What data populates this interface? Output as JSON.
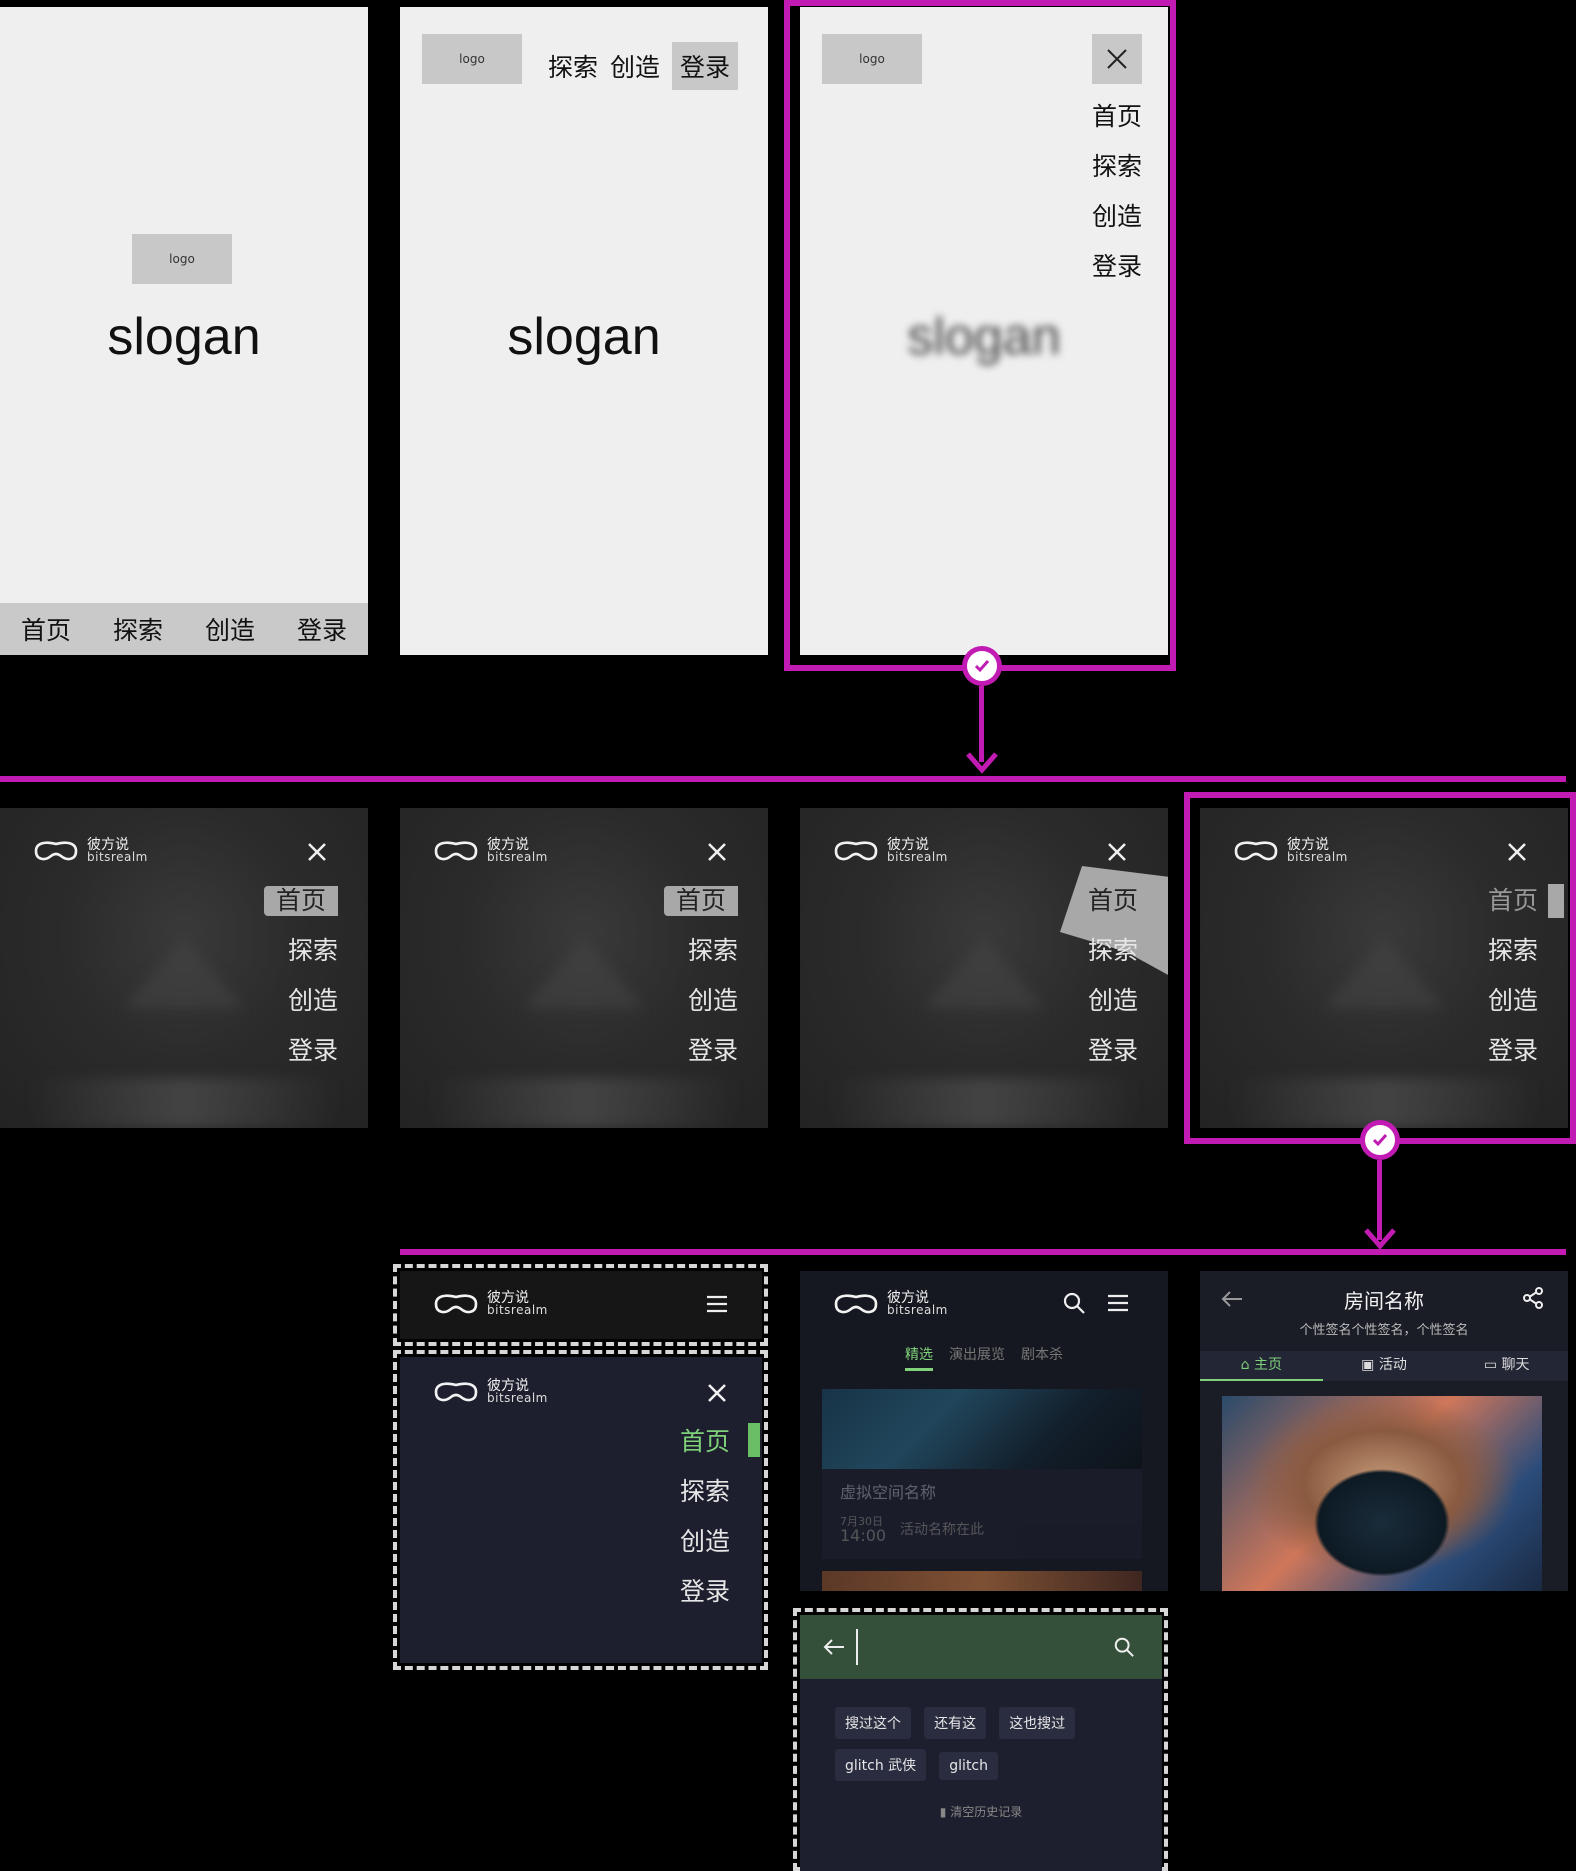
{
  "colors": {
    "accent_magenta": "#c21bb4",
    "accent_green": "#7fd27a",
    "dark_bg": "#2b2b2b",
    "navy_bg": "#1d1f2e",
    "search_header": "#34503a"
  },
  "wireframe": {
    "logo_label": "logo",
    "slogan": "slogan",
    "nav": [
      "首页",
      "探索",
      "创造",
      "登录"
    ],
    "top_nav": [
      "探索",
      "创造",
      "登录"
    ]
  },
  "brand": {
    "name_cn": "彼方说",
    "name_en": "bitsrealm"
  },
  "dark_menu": {
    "items": [
      "首页",
      "探索",
      "创造",
      "登录"
    ]
  },
  "feed": {
    "tabs": [
      "精选",
      "演出展览",
      "剧本杀"
    ],
    "card_title": "虚拟空间名称",
    "card_date": "7月30日",
    "card_time": "14:00",
    "card_activity": "活动名称在此"
  },
  "search": {
    "history": [
      "搜过这个",
      "还有这",
      "这也搜过",
      "glitch 武侠",
      "glitch"
    ],
    "clear_label": "清空历史记录"
  },
  "room": {
    "title": "房间名称",
    "signature": "个性签名个性签名，个性签名",
    "tabs": [
      "主页",
      "活动",
      "聊天"
    ]
  }
}
